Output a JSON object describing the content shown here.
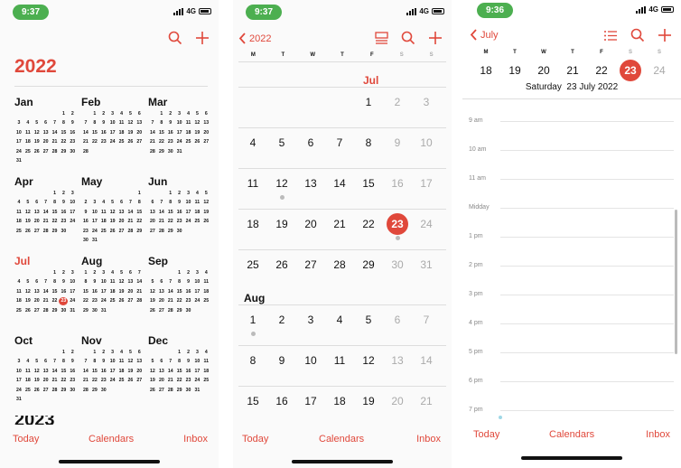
{
  "status": {
    "time1": "9:37",
    "time2": "9:37",
    "time3": "9:36",
    "net": "4G"
  },
  "tabs": {
    "today": "Today",
    "calendars": "Calendars",
    "inbox": "Inbox"
  },
  "year_view": {
    "title": "2022",
    "next_year": "2023",
    "months": [
      {
        "name": "Jan",
        "offset": 5,
        "days": 31
      },
      {
        "name": "Feb",
        "offset": 1,
        "days": 28
      },
      {
        "name": "Mar",
        "offset": 1,
        "days": 31
      },
      {
        "name": "Apr",
        "offset": 4,
        "days": 30
      },
      {
        "name": "May",
        "offset": 6,
        "days": 31
      },
      {
        "name": "Jun",
        "offset": 2,
        "days": 30
      },
      {
        "name": "Jul",
        "offset": 4,
        "days": 31,
        "current": true,
        "today": 23
      },
      {
        "name": "Aug",
        "offset": 0,
        "days": 31
      },
      {
        "name": "Sep",
        "offset": 3,
        "days": 30
      },
      {
        "name": "Oct",
        "offset": 5,
        "days": 31
      },
      {
        "name": "Nov",
        "offset": 1,
        "days": 30
      },
      {
        "name": "Dec",
        "offset": 3,
        "days": 31
      }
    ]
  },
  "month_view": {
    "back_label": "2022",
    "weekdays": [
      "M",
      "T",
      "W",
      "T",
      "F",
      "S",
      "S"
    ],
    "jul_label": "Jul",
    "aug_label": "Aug",
    "jul_weeks": [
      [
        "",
        "",
        "",
        "",
        "1",
        "2",
        "3"
      ],
      [
        "4",
        "5",
        "6",
        "7",
        "8",
        "9",
        "10"
      ],
      [
        "11",
        "12",
        "13",
        "14",
        "15",
        "16",
        "17"
      ],
      [
        "18",
        "19",
        "20",
        "21",
        "22",
        "23",
        "24"
      ],
      [
        "25",
        "26",
        "27",
        "28",
        "29",
        "30",
        "31"
      ]
    ],
    "aug_weeks": [
      [
        "1",
        "2",
        "3",
        "4",
        "5",
        "6",
        "7"
      ],
      [
        "8",
        "9",
        "10",
        "11",
        "12",
        "13",
        "14"
      ],
      [
        "15",
        "16",
        "17",
        "18",
        "19",
        "20",
        "21"
      ]
    ],
    "selected": "23"
  },
  "day_view": {
    "back_label": "July",
    "weekdays": [
      "M",
      "T",
      "W",
      "T",
      "F",
      "S",
      "S"
    ],
    "week_days": [
      "18",
      "19",
      "20",
      "21",
      "22",
      "23",
      "24"
    ],
    "selected": "23",
    "date_label": "Saturday  23 July 2022",
    "hours": [
      "9 am",
      "10 am",
      "11 am",
      "Midday",
      "1 pm",
      "2 pm",
      "3 pm",
      "4 pm",
      "5 pm",
      "6 pm",
      "7 pm"
    ]
  },
  "colors": {
    "accent": "#e0483b",
    "status_pill": "#4caf50"
  }
}
